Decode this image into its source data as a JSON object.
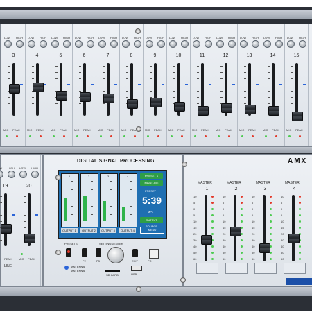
{
  "brand_text": "AMX",
  "dsp_title": "DIGITAL SIGNAL PROCESSING",
  "eq_labels": {
    "low": "LOW",
    "high": "HIGH"
  },
  "top_channels": [
    "3",
    "4",
    "5",
    "6",
    "7",
    "8",
    "9",
    "10",
    "11",
    "12",
    "13",
    "14",
    "15"
  ],
  "bottom_channels": [
    "19",
    "20"
  ],
  "strip_footer": {
    "mic": "MIC",
    "peak": "PEAK"
  },
  "line_label": "LINE",
  "fader_scale": [
    "10",
    "5",
    "0",
    "5",
    "10",
    "15",
    "20",
    "30",
    "40",
    "50",
    "60"
  ],
  "master": {
    "title": "MASTER",
    "numbers": [
      "1",
      "2",
      "3",
      "4"
    ]
  },
  "lcd": {
    "outputs": [
      {
        "number": "1",
        "label": "OUTPUT 1",
        "level": 0.55
      },
      {
        "number": "2",
        "label": "OUTPUT 2",
        "level": 0.6
      },
      {
        "number": "3",
        "label": "OUTPUT 3",
        "level": 0.48
      },
      {
        "number": "4",
        "label": "OUTPUT 4",
        "level": 0.33
      }
    ],
    "preset": "PRESET 1",
    "source": "MAIN LINE",
    "mode": "PRESET",
    "time": "5:39",
    "format": "MP3",
    "aux": "OUTPUT SOURCE",
    "menu": "MENU"
  },
  "controls": {
    "presets": "PRESETS",
    "settings": "SETTINGS/ENTER",
    "p2": "P2",
    "p3": "P3",
    "exit": "EXIT",
    "pc": "PC",
    "antenna1": "ANTENNA",
    "antenna2": "ANTENNA",
    "sdcard": "SD CARD",
    "usb": "USB"
  },
  "colors": {
    "lcd_bg": "#1f6fb2",
    "lcd_green": "#2e9e47",
    "panel": "#e6eaef",
    "led_green": "#4ecb52",
    "led_red": "#e23a2b"
  }
}
